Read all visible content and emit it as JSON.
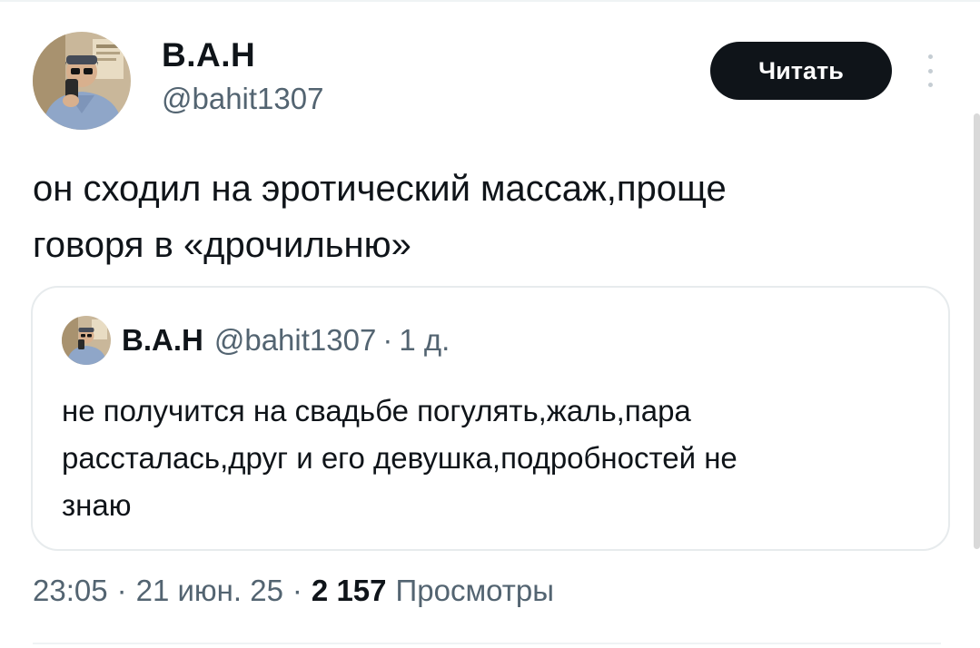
{
  "author": {
    "display_name": "В.А.Н",
    "handle": "@bahit1307"
  },
  "header": {
    "read_label": "Читать",
    "more_icon": "more-vertical-icon"
  },
  "tweet": {
    "text": "он сходил на эротический массаж,проще\nговоря в «дрочильню»"
  },
  "quote": {
    "display_name": "В.А.Н",
    "handle": "@bahit1307",
    "separator": "·",
    "time": "1 д.",
    "text": "не получится на свадьбе погулять,жаль,пара\nрассталась,друг и его девушка,подробностей не\nзнаю"
  },
  "meta": {
    "time": "23:05",
    "date": "21 июн. 25",
    "separator": "·",
    "views_count": "2 157",
    "views_label": "Просмотры"
  },
  "colors": {
    "text_primary": "#0f1419",
    "text_secondary": "#536471",
    "border": "#e7ebed",
    "button_bg": "#0f1419"
  }
}
